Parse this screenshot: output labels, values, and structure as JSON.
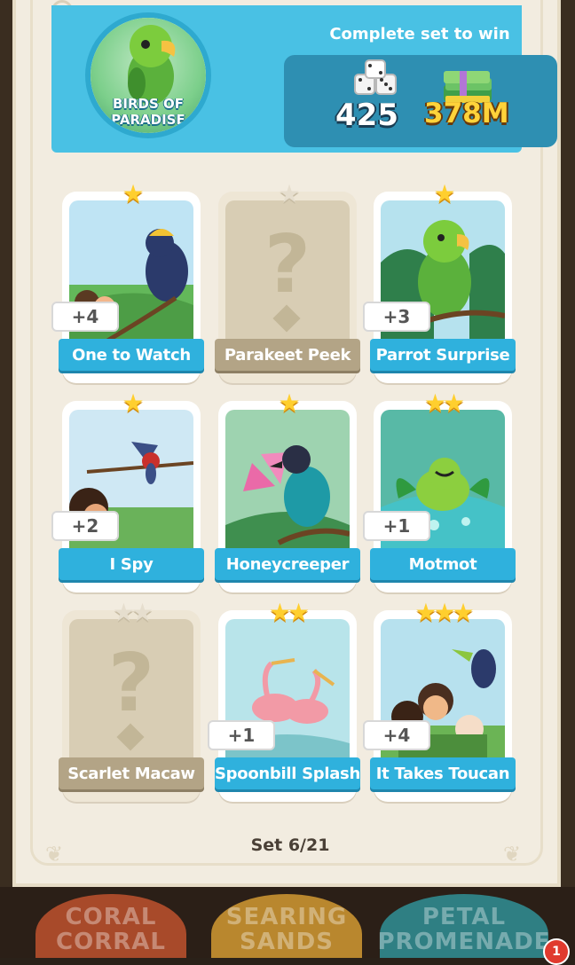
{
  "album": {
    "title": "BIRDS OF PARADISE",
    "reward_heading": "Complete set to win",
    "reward_dice": "425",
    "reward_money": "378M"
  },
  "cards": [
    {
      "name": "One to Watch",
      "stars": 1,
      "count": "+4",
      "owned": true,
      "art": "art-one-to-watch"
    },
    {
      "name": "Parakeet Peek",
      "stars": 1,
      "count": "",
      "owned": false,
      "art": "locked"
    },
    {
      "name": "Parrot Surprise",
      "stars": 1,
      "count": "+3",
      "owned": true,
      "art": "art-parrot"
    },
    {
      "name": "I Spy",
      "stars": 1,
      "count": "+2",
      "owned": true,
      "art": "art-i-spy"
    },
    {
      "name": "Honeycreeper",
      "stars": 1,
      "count": "",
      "owned": true,
      "art": "art-honeycreeper"
    },
    {
      "name": "Motmot",
      "stars": 2,
      "count": "+1",
      "owned": true,
      "art": "art-motmot"
    },
    {
      "name": "Scarlet Macaw",
      "stars": 2,
      "count": "",
      "owned": false,
      "art": "locked"
    },
    {
      "name": "Spoonbill Splash",
      "stars": 2,
      "count": "+1",
      "owned": true,
      "art": "art-spoonbill"
    },
    {
      "name": "It Takes Toucan",
      "stars": 3,
      "count": "+4",
      "owned": true,
      "art": "art-toucan"
    }
  ],
  "set_counter": "Set 6/21",
  "bottom_tabs": [
    "CORAL CORRAL",
    "SEARING SANDS",
    "PETAL PROMENADE"
  ],
  "notification_count": "1",
  "colors": {
    "accent": "#49c1e4",
    "label": "#2fb1dd",
    "locked_label": "#b3a486",
    "gold": "#ffcf2e"
  }
}
